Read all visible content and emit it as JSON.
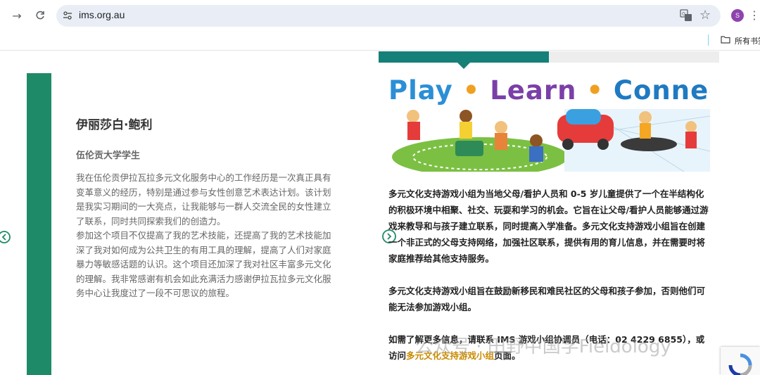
{
  "browser": {
    "url": "ims.org.au",
    "profile_initial": "S",
    "bookmarks_folder": "所有书签"
  },
  "testimonial": {
    "name": "伊丽莎白·鲍利",
    "role": "伍伦贡大学学生",
    "paragraph1": "我在伍伦贡伊拉瓦拉多元文化服务中心的工作经历是一次真正具有变革意义的经历，特别是通过参与女性创意艺术表达计划。该计划是我实习期间的一大亮点，让我能够与一群人交流全民的女性建立了联系，同时共同探索我们的创造力。",
    "paragraph2": "参加这个项目不仅提高了我的艺术技能，还提高了我的艺术技能加深了我对如何成为公共卫生的有用工具的理解，提高了人们对家庭暴力等敏感话题的认识。这个项目还加深了我对社区丰富多元文化的理解。我非常感谢有机会如此充满活力感谢伊拉瓦拉多元文化服务中心让我度过了一段不可思议的旅程。"
  },
  "banner": {
    "word1": "Play",
    "dot": "•",
    "word2": "Learn",
    "word3": "Connect",
    "colors": {
      "play": "#2a8fd6",
      "learn": "#7b3fa8",
      "connect": "#1f7ac2",
      "dot": "#f0a020"
    }
  },
  "info": {
    "p1": "多元文化支持游戏小组为当地父母/看护人员和 0-5 岁儿童提供了一个在半结构化的积极环境中相聚、社交、玩耍和学习的机会。它旨在让父母/看护人员能够通过游戏来教导和与孩子建立联系，同时提高入学准备。多元文化支持游戏小组旨在创建一个非正式的父母支持网络，加强社区联系，提供有用的育儿信息，并在需要时将家庭推荐给其他支持服务。",
    "p2": "多元文化支持游戏小组旨在鼓励新移民和难民社区的父母和孩子参加，否则他们可能无法参加游戏小组。",
    "p3_prefix": "如需了解更多信息，请联系 IMS 游戏小组协调员（电话：02 4229 6855），或访问",
    "p3_link": "多元文化支持游戏小组",
    "p3_suffix": "页面。"
  },
  "watermark": "公众号 · 田野中国学Fieldology",
  "colors": {
    "accent_green": "#1f8a68",
    "tab_teal": "#148078",
    "link_gold": "#c98a00"
  }
}
